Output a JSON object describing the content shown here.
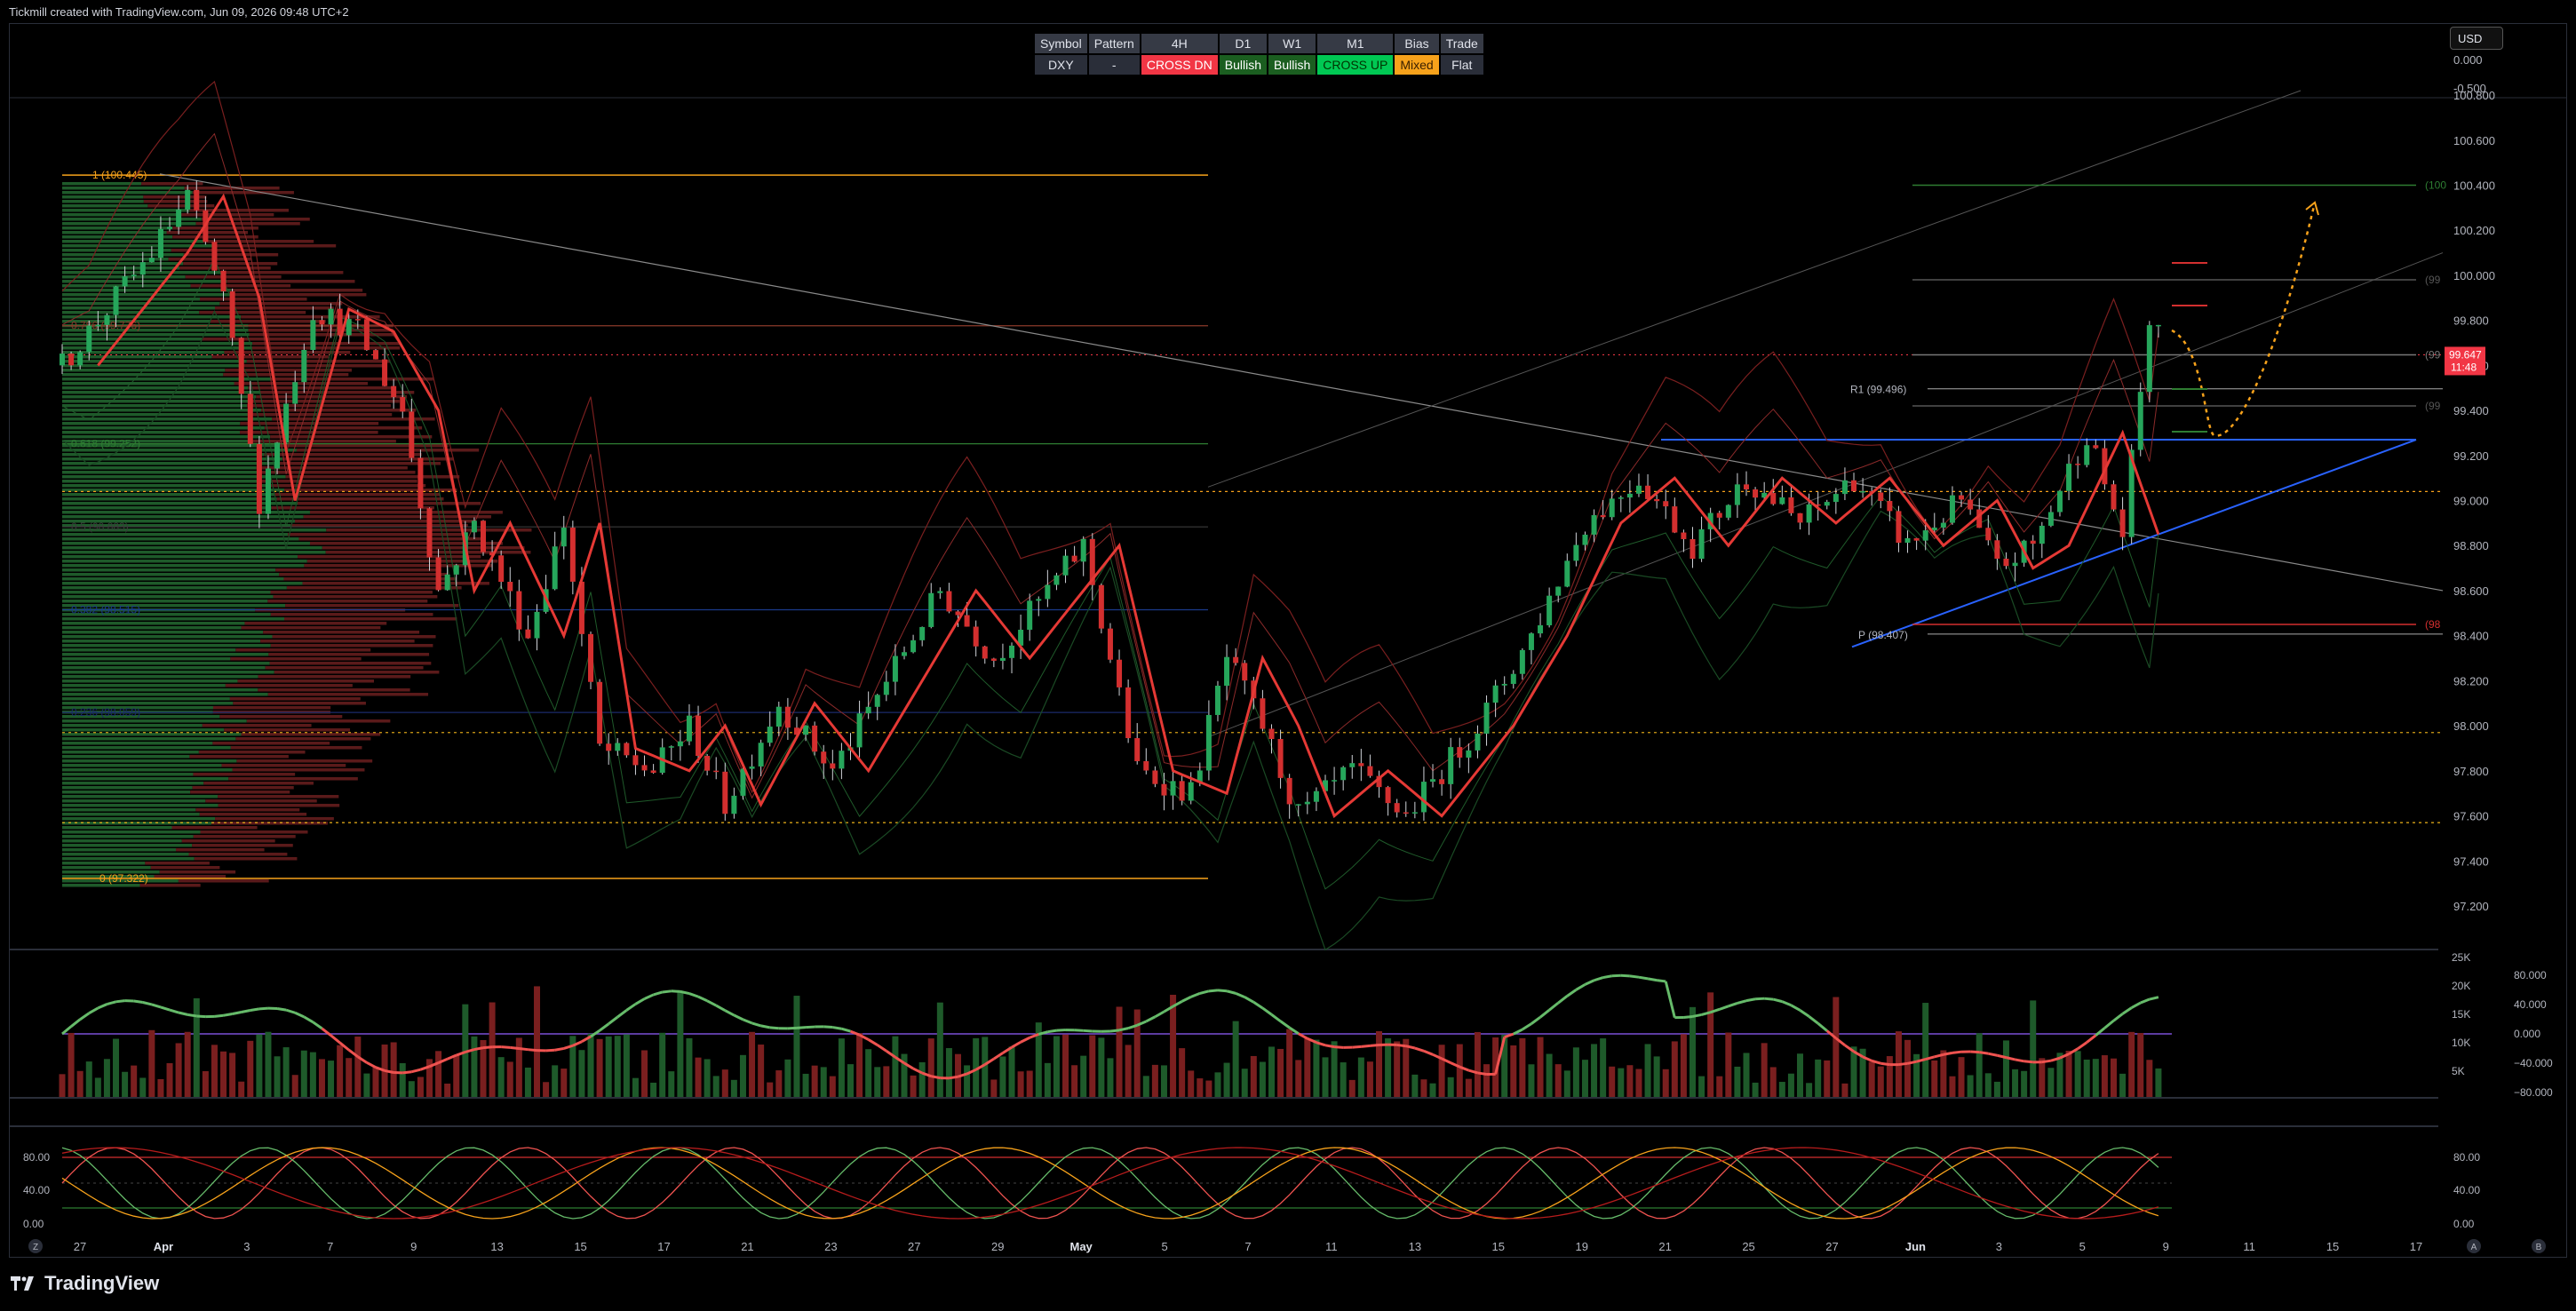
{
  "header": {
    "title": "Tickmill created with TradingView.com, Jun 09, 2026 09:48 UTC+2"
  },
  "currency_button": "USD",
  "signal_table": {
    "headers": [
      "Symbol",
      "Pattern",
      "4H",
      "D1",
      "W1",
      "M1",
      "Bias",
      "Trade"
    ],
    "row": [
      "DXY",
      "-",
      "CROSS DN",
      "Bullish",
      "Bullish",
      "CROSS UP",
      "Mixed",
      "Flat"
    ],
    "colors": [
      "#2a2e39",
      "#2a2e39",
      "#f23645",
      "#1b5e20",
      "#1b5e20",
      "#00c853",
      "#f7a21b",
      "#2a2e39"
    ]
  },
  "price_axis": {
    "ticks": [
      "100.800",
      "100.600",
      "100.400",
      "100.200",
      "100.000",
      "99.800",
      "99.600",
      "99.400",
      "99.200",
      "99.000",
      "98.800",
      "98.600",
      "98.400",
      "98.200",
      "98.000",
      "97.800",
      "97.600",
      "97.400",
      "97.200"
    ],
    "current_price": "99.647",
    "countdown": "11:48",
    "top_ticks": [
      "0.000",
      "-0.500"
    ]
  },
  "fib_labels": {
    "top": "1 (100.445)",
    "bottom": "0 (97.322)",
    "l786": "0.786 (99.776)",
    "l618": "0.618 (99.252)",
    "l5": "0.5 (98.883)",
    "l382": "0.382 (98.515)",
    "l236": "0.236 (98.059)"
  },
  "pivot_labels": {
    "r1": "R1 (99.496)",
    "p": "P (98.407)",
    "right_100": "(100",
    "right_99a": "(99",
    "right_99b": "(99",
    "right_99c": "(99",
    "right_98": "(98"
  },
  "volume_axis": {
    "left": [
      "25K",
      "20K",
      "15K",
      "10K",
      "5K"
    ],
    "right": [
      "80.000",
      "40.000",
      "0.000",
      "−40.000",
      "−80.000"
    ]
  },
  "stoch_axis": {
    "left": [
      "80.00",
      "40.00",
      "0.00"
    ],
    "right": [
      "80.00",
      "40.00",
      "0.00"
    ]
  },
  "time_axis": {
    "labels": [
      "27",
      "Apr",
      "3",
      "7",
      "9",
      "13",
      "15",
      "17",
      "21",
      "23",
      "27",
      "29",
      "May",
      "5",
      "7",
      "11",
      "13",
      "15",
      "19",
      "21",
      "25",
      "27",
      "Jun",
      "3",
      "5",
      "9",
      "11",
      "15",
      "17"
    ]
  },
  "corner_buttons": {
    "left": "Z",
    "right_a": "A",
    "right_b": "B"
  },
  "footer": {
    "brand": "TradingView"
  },
  "colors": {
    "bull": "#26a65b",
    "bear": "#d32f2f",
    "fib": "#f7a21b",
    "accent_blue": "#2962ff",
    "price_tag": "#f23645"
  }
}
